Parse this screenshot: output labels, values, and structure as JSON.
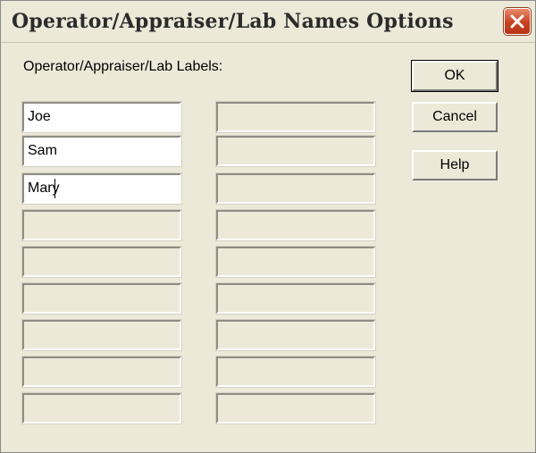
{
  "window": {
    "title": "Operator/Appraiser/Lab Names Options"
  },
  "labels_heading": "Operator/Appraiser/Lab Labels:",
  "fields": {
    "left": [
      {
        "value": "Joe",
        "enabled": true
      },
      {
        "value": "Sam",
        "enabled": true
      },
      {
        "value": "Mary",
        "enabled": true
      },
      {
        "value": "",
        "enabled": false
      },
      {
        "value": "",
        "enabled": false
      },
      {
        "value": "",
        "enabled": false
      },
      {
        "value": "",
        "enabled": false
      },
      {
        "value": "",
        "enabled": false
      },
      {
        "value": "",
        "enabled": false
      }
    ],
    "right": [
      {
        "value": "",
        "enabled": false
      },
      {
        "value": "",
        "enabled": false
      },
      {
        "value": "",
        "enabled": false
      },
      {
        "value": "",
        "enabled": false
      },
      {
        "value": "",
        "enabled": false
      },
      {
        "value": "",
        "enabled": false
      },
      {
        "value": "",
        "enabled": false
      },
      {
        "value": "",
        "enabled": false
      },
      {
        "value": "",
        "enabled": false
      }
    ]
  },
  "buttons": {
    "ok": "OK",
    "cancel": "Cancel",
    "help": "Help"
  },
  "icons": {
    "close": "close-icon"
  },
  "colors": {
    "dialog_bg": "#ece9d8",
    "close_button": "#c7411f",
    "field_enabled_bg": "#ffffff"
  }
}
